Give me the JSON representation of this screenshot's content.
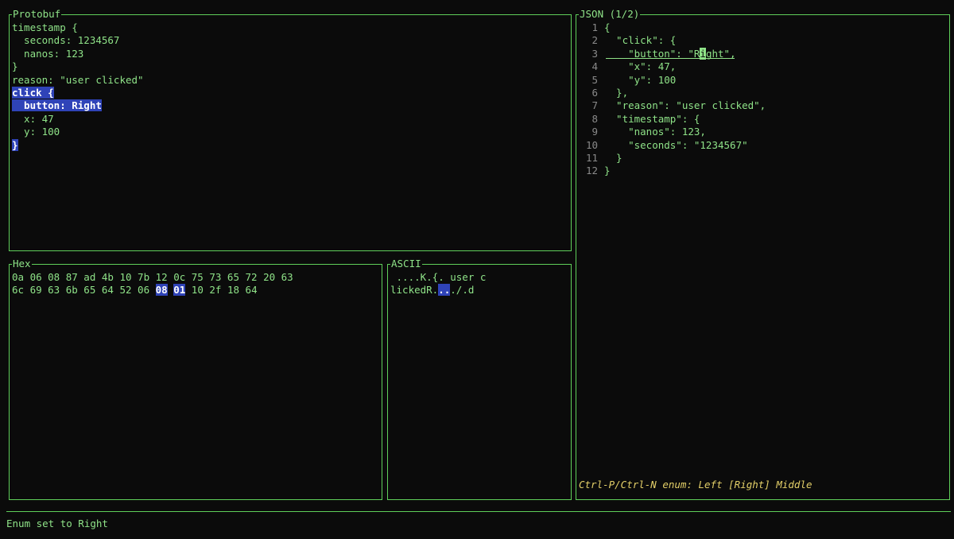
{
  "protobuf": {
    "title": "Protobuf",
    "lines": [
      "timestamp {",
      "  seconds: 1234567",
      "  nanos: 123",
      "}",
      "reason: \"user clicked\"",
      "click {",
      "  button: Right",
      "  x: 47",
      "  y: 100",
      "}"
    ]
  },
  "json": {
    "title": "JSON (1/2)",
    "line_numbers": [
      "1",
      "2",
      "3",
      "4",
      "5",
      "6",
      "7",
      "8",
      "9",
      "10",
      "11",
      "12"
    ],
    "lines": [
      "{",
      "  \"click\": {",
      "    \"button\": \"Right\",",
      "    \"x\": 47,",
      "    \"y\": 100",
      "  },",
      "  \"reason\": \"user clicked\",",
      "  \"timestamp\": {",
      "    \"nanos\": 123,",
      "    \"seconds\": \"1234567\"",
      "  }",
      "}"
    ],
    "cursor_line": {
      "before": "    \"button\": \"R",
      "cursor_char": "i",
      "after": "ght\","
    },
    "enum_hint": "Ctrl-P/Ctrl-N enum: Left [Right] Middle"
  },
  "hex": {
    "title": "Hex",
    "line1": "0a 06 08 87 ad 4b 10 7b 12 0c 75 73 65 72 20 63",
    "line2_before": "6c 69 63 6b 65 64 52 06 ",
    "line2_sel1": "08",
    "line2_gap": " ",
    "line2_sel2": "01",
    "line2_after": " 10 2f 18 64"
  },
  "ascii": {
    "title": "ASCII",
    "line1": " ....K.{. user c",
    "line2_before": "lickedR.",
    "line2_sel": "..",
    "line2_after": "./.d"
  },
  "status": {
    "message": "Enum set to Right"
  }
}
